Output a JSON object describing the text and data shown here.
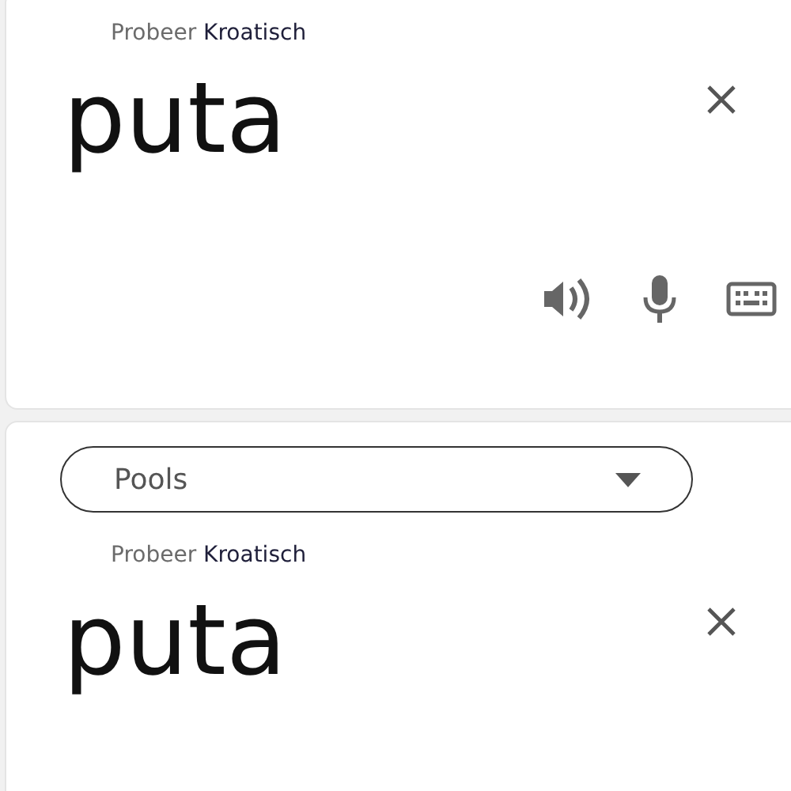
{
  "panels": [
    {
      "hint": {
        "prefix": "Probeer",
        "language": "Kroatisch"
      },
      "text": "puta",
      "tools": [
        {
          "kind": "speaker"
        },
        {
          "kind": "microphone"
        },
        {
          "kind": "keyboard"
        }
      ]
    },
    {
      "dropdown": {
        "value": "Pools"
      },
      "hint": {
        "prefix": "Probeer",
        "language": "Kroatisch"
      },
      "text": "puta"
    }
  ]
}
